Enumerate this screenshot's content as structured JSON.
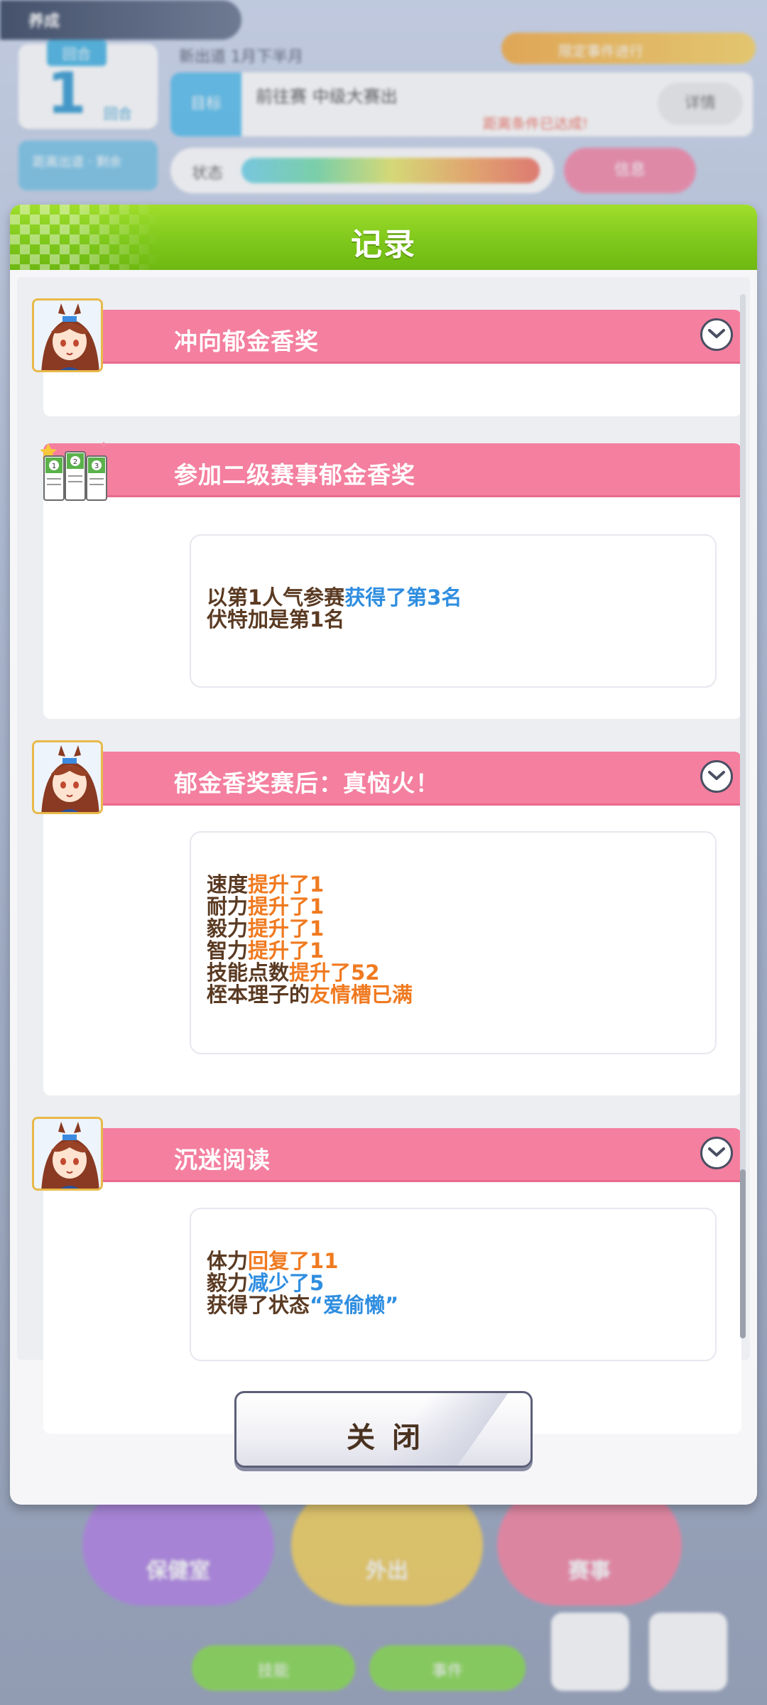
{
  "background_hud": {
    "top_label": "养成",
    "turn_label": "回合",
    "turn_number": "1",
    "turn_unit": "回合",
    "turn_info": "距离出道 · 剩余",
    "date_text": "新出道 1月下半月",
    "goal_tag": "目标",
    "goal_text": "前往赛 中级大赛出",
    "goal_note": "距离条件已达成!",
    "goal_button": "详情",
    "mood_label": "状态",
    "mood_button": "信息",
    "event_pill": "限定事件进行",
    "menu_rest": "保健室",
    "menu_outing": "外出",
    "menu_race": "赛事",
    "bottom_btn_1": "技能",
    "bottom_btn_2": "事件"
  },
  "modal": {
    "title": "记录",
    "close_label": "关闭"
  },
  "log": [
    {
      "title": "冲向郁金香奖",
      "icon": "character-avatar",
      "expandable": true
    },
    {
      "title": "参加二级赛事郁金香奖",
      "icon": "race-result-icon",
      "lines": [
        [
          {
            "t": "以第1人气参赛",
            "c": "normal"
          },
          {
            "t": "获得了第3名",
            "c": "blue"
          }
        ],
        [
          {
            "t": "伏特加是第1名",
            "c": "normal"
          }
        ]
      ]
    },
    {
      "title": "郁金香奖赛后：真恼火！",
      "icon": "character-avatar",
      "expandable": true,
      "lines": [
        [
          {
            "t": "速度",
            "c": "normal"
          },
          {
            "t": "提升了1",
            "c": "orange"
          }
        ],
        [
          {
            "t": "耐力",
            "c": "normal"
          },
          {
            "t": "提升了1",
            "c": "orange"
          }
        ],
        [
          {
            "t": "毅力",
            "c": "normal"
          },
          {
            "t": "提升了1",
            "c": "orange"
          }
        ],
        [
          {
            "t": "智力",
            "c": "normal"
          },
          {
            "t": "提升了1",
            "c": "orange"
          }
        ],
        [
          {
            "t": "技能点数",
            "c": "normal"
          },
          {
            "t": "提升了52",
            "c": "orange"
          }
        ],
        [
          {
            "t": "桎本理子的",
            "c": "normal"
          },
          {
            "t": "友情槽已满",
            "c": "orange"
          }
        ]
      ]
    },
    {
      "title": "沉迷阅读",
      "icon": "character-avatar",
      "expandable": true,
      "lines": [
        [
          {
            "t": "体力",
            "c": "normal"
          },
          {
            "t": "回复了11",
            "c": "orange"
          }
        ],
        [
          {
            "t": "毅力",
            "c": "normal"
          },
          {
            "t": "减少了5",
            "c": "blue"
          }
        ],
        [
          {
            "t": "获得了状态",
            "c": "normal"
          },
          {
            "t": "“爱偷懒”",
            "c": "blue"
          }
        ]
      ]
    }
  ],
  "colors": {
    "header_green": "#7fc81c",
    "entry_pink": "#f47f9f",
    "text_brown": "#5a3a22",
    "accent_orange": "#f07a20",
    "accent_blue": "#2f8ee0"
  }
}
